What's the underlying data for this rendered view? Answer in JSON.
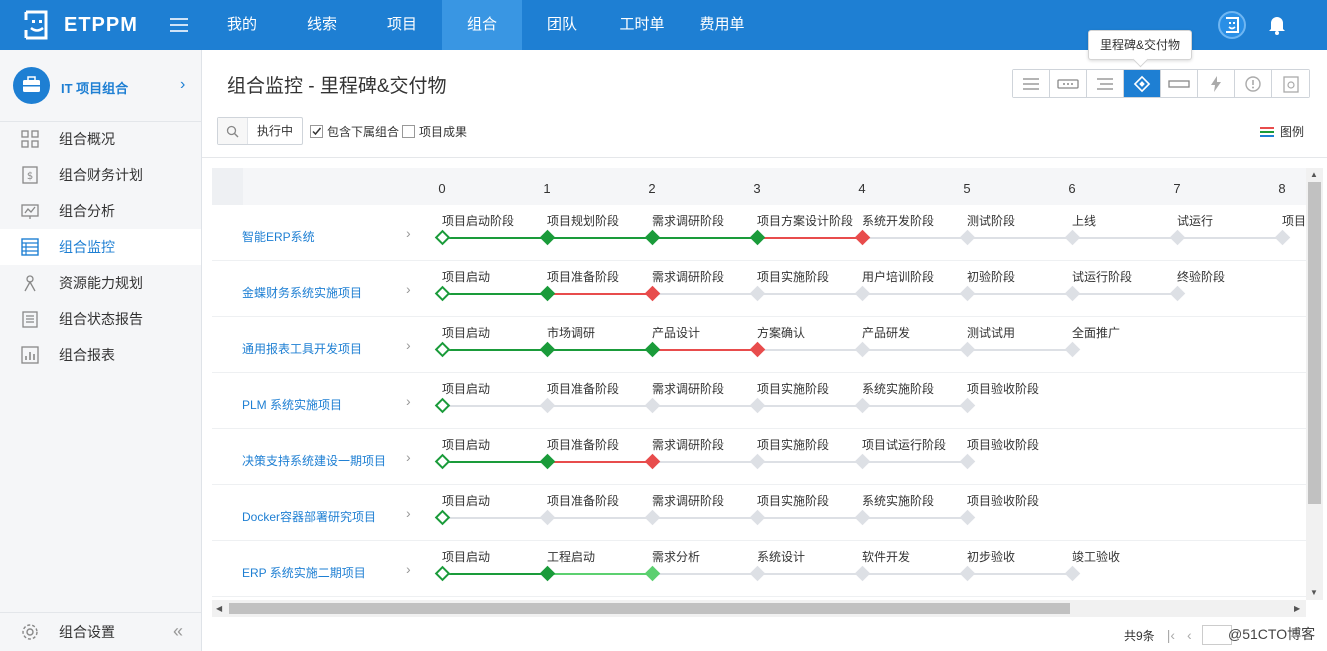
{
  "app": {
    "name": "ETPPM"
  },
  "nav": [
    "我的",
    "线索",
    "项目",
    "组合",
    "团队",
    "工时单",
    "费用单"
  ],
  "tooltip": "里程碑&交付物",
  "sidebar": {
    "title": "IT 项目组合",
    "items": [
      {
        "label": "组合概况",
        "icon": "grid-icon"
      },
      {
        "label": "组合财务计划",
        "icon": "finance-icon"
      },
      {
        "label": "组合分析",
        "icon": "analysis-icon"
      },
      {
        "label": "组合监控",
        "icon": "monitor-icon"
      },
      {
        "label": "资源能力规划",
        "icon": "resource-icon"
      },
      {
        "label": "组合状态报告",
        "icon": "report-icon"
      },
      {
        "label": "组合报表",
        "icon": "chart-icon"
      }
    ],
    "active_index": 3,
    "footer": "组合设置"
  },
  "page": {
    "title": "组合监控 - 里程碑&交付物",
    "filter_status": "执行中",
    "checkbox_sub": "包含下属组合",
    "checkbox_sub_checked": true,
    "checkbox_result": "项目成果",
    "checkbox_result_checked": false,
    "legend": "图例"
  },
  "colors": {
    "done": "#1a9b3a",
    "late": "#e84c4c",
    "current": "#5cd070",
    "pending": "#dde0e5",
    "accent": "#1e7fd3"
  },
  "columns": [
    "0",
    "1",
    "2",
    "3",
    "4",
    "5",
    "6",
    "7",
    "8"
  ],
  "projects": [
    {
      "name": "智能ERP系统",
      "milestones": [
        {
          "label": "项目启动阶段",
          "status": "start"
        },
        {
          "label": "项目规划阶段",
          "status": "done"
        },
        {
          "label": "需求调研阶段",
          "status": "done"
        },
        {
          "label": "项目方案设计阶段",
          "status": "done"
        },
        {
          "label": "系统开发阶段",
          "status": "late"
        },
        {
          "label": "测试阶段",
          "status": "pending"
        },
        {
          "label": "上线",
          "status": "pending"
        },
        {
          "label": "试运行",
          "status": "pending"
        },
        {
          "label": "项目",
          "status": "pending"
        }
      ]
    },
    {
      "name": "金蝶财务系统实施项目",
      "milestones": [
        {
          "label": "项目启动",
          "status": "start"
        },
        {
          "label": "项目准备阶段",
          "status": "done"
        },
        {
          "label": "需求调研阶段",
          "status": "late"
        },
        {
          "label": "项目实施阶段",
          "status": "pending"
        },
        {
          "label": "用户培训阶段",
          "status": "pending"
        },
        {
          "label": "初验阶段",
          "status": "pending"
        },
        {
          "label": "试运行阶段",
          "status": "pending"
        },
        {
          "label": "终验阶段",
          "status": "pending"
        }
      ]
    },
    {
      "name": "通用报表工具开发项目",
      "milestones": [
        {
          "label": "项目启动",
          "status": "start"
        },
        {
          "label": "市场调研",
          "status": "done"
        },
        {
          "label": "产品设计",
          "status": "done"
        },
        {
          "label": "方案确认",
          "status": "late"
        },
        {
          "label": "产品研发",
          "status": "pending"
        },
        {
          "label": "测试试用",
          "status": "pending"
        },
        {
          "label": "全面推广",
          "status": "pending"
        }
      ]
    },
    {
      "name": "PLM 系统实施项目",
      "milestones": [
        {
          "label": "项目启动",
          "status": "start"
        },
        {
          "label": "项目准备阶段",
          "status": "pending"
        },
        {
          "label": "需求调研阶段",
          "status": "pending"
        },
        {
          "label": "项目实施阶段",
          "status": "pending"
        },
        {
          "label": "系统实施阶段",
          "status": "pending"
        },
        {
          "label": "项目验收阶段",
          "status": "pending"
        }
      ]
    },
    {
      "name": "决策支持系统建设一期项目",
      "milestones": [
        {
          "label": "项目启动",
          "status": "start"
        },
        {
          "label": "项目准备阶段",
          "status": "done"
        },
        {
          "label": "需求调研阶段",
          "status": "late"
        },
        {
          "label": "项目实施阶段",
          "status": "pending"
        },
        {
          "label": "项目试运行阶段",
          "status": "pending"
        },
        {
          "label": "项目验收阶段",
          "status": "pending"
        }
      ]
    },
    {
      "name": "Docker容器部署研究项目",
      "milestones": [
        {
          "label": "项目启动",
          "status": "start"
        },
        {
          "label": "项目准备阶段",
          "status": "pending"
        },
        {
          "label": "需求调研阶段",
          "status": "pending"
        },
        {
          "label": "项目实施阶段",
          "status": "pending"
        },
        {
          "label": "系统实施阶段",
          "status": "pending"
        },
        {
          "label": "项目验收阶段",
          "status": "pending"
        }
      ]
    },
    {
      "name": "ERP 系统实施二期项目",
      "milestones": [
        {
          "label": "项目启动",
          "status": "start"
        },
        {
          "label": "工程启动",
          "status": "done"
        },
        {
          "label": "需求分析",
          "status": "current"
        },
        {
          "label": "系统设计",
          "status": "pending"
        },
        {
          "label": "软件开发",
          "status": "pending"
        },
        {
          "label": "初步验收",
          "status": "pending"
        },
        {
          "label": "竣工验收",
          "status": "pending"
        }
      ]
    }
  ],
  "pager": {
    "total": "共9条"
  },
  "watermark": "@51CTO博客"
}
